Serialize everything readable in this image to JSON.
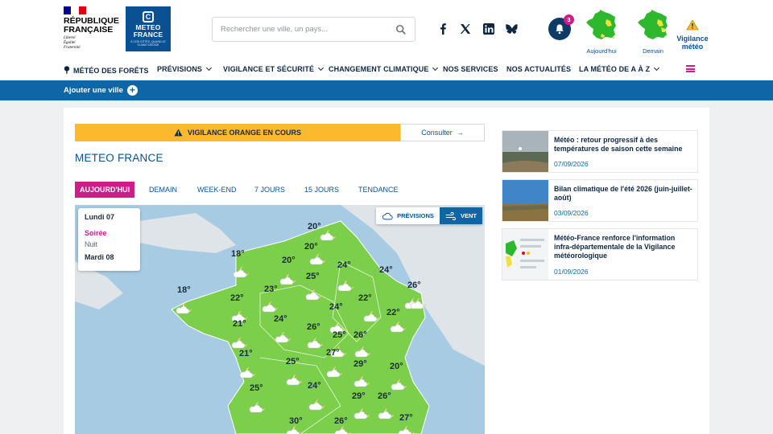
{
  "header": {
    "rf": {
      "title": "République Française",
      "motto": [
        "Liberté",
        "Égalité",
        "Fraternité"
      ],
      "flag_colors": [
        "#000091",
        "#ffffff",
        "#e1000f"
      ]
    },
    "mf": {
      "name": "METEO FRANCE",
      "tagline": "À VOS CÔTÉS, QUAND LE CLIMAT DÉCIDE",
      "brand_color": "#0a5194"
    },
    "search": {
      "placeholder": "Rechercher une ville, un pays..."
    },
    "social": [
      "facebook-icon",
      "x-icon",
      "linkedin-icon",
      "bluesky-icon"
    ],
    "notifications": {
      "count": "3"
    },
    "vigilance_maps": [
      {
        "label": "Aujourd'hui"
      },
      {
        "label": "Demain"
      }
    ],
    "vigilance_meteo": {
      "label": "Vigilance météo"
    }
  },
  "nav": {
    "items": [
      {
        "label": "Météo des forêts",
        "dropdown": false,
        "icon": "tree-icon"
      },
      {
        "label": "Prévisions",
        "dropdown": true
      },
      {
        "label": "Vigilance et sécurité",
        "dropdown": true
      },
      {
        "label": "Changement climatique",
        "dropdown": true
      },
      {
        "label": "Nos services",
        "dropdown": false
      },
      {
        "label": "Nos actualités",
        "dropdown": false
      },
      {
        "label": "La météo de A à Z",
        "dropdown": true
      }
    ],
    "accent": "#d01c8b"
  },
  "bluebar": {
    "add_city": "Ajouter une ville"
  },
  "vigilance_banner": {
    "text": "VIGILANCE ORANGE EN COURS",
    "action": "Consulter",
    "color": "#fdb92e"
  },
  "main": {
    "title": "METEO FRANCE",
    "tabs": [
      {
        "label": "AUJOURD'HUI",
        "active": true
      },
      {
        "label": "DEMAIN"
      },
      {
        "label": "WEEK-END"
      },
      {
        "label": "7 JOURS"
      },
      {
        "label": "15 JOURS"
      },
      {
        "label": "TENDANCE"
      }
    ],
    "daybox": {
      "day1": "Lundi 07",
      "period_active": "Soirée",
      "period_next": "Nuit",
      "day2": "Mardi 08"
    },
    "toggle": {
      "forecast": "PRÉVISIONS",
      "wind": "VENT"
    },
    "temps": [
      "20°",
      "18°",
      "20°",
      "20°",
      "24°",
      "24°",
      "18°",
      "22°",
      "23°",
      "25°",
      "26°",
      "22°",
      "24°",
      "22°",
      "21°",
      "24°",
      "26°",
      "25°",
      "21°",
      "27°",
      "26°",
      "25°",
      "29°",
      "20°",
      "25°",
      "24°",
      "29°",
      "26°",
      "30°",
      "26°",
      "27°"
    ]
  },
  "news": [
    {
      "title": "Météo : retour progressif à des températures de saison cette semaine",
      "date": "07/09/2026"
    },
    {
      "title": "Bilan climatique de l'été 2026 (juin-juillet-août)",
      "date": "03/09/2026"
    },
    {
      "title": "Météo-France renforce l'information infra-départementale de la Vigilance météorologique",
      "date": "01/09/2026"
    }
  ]
}
